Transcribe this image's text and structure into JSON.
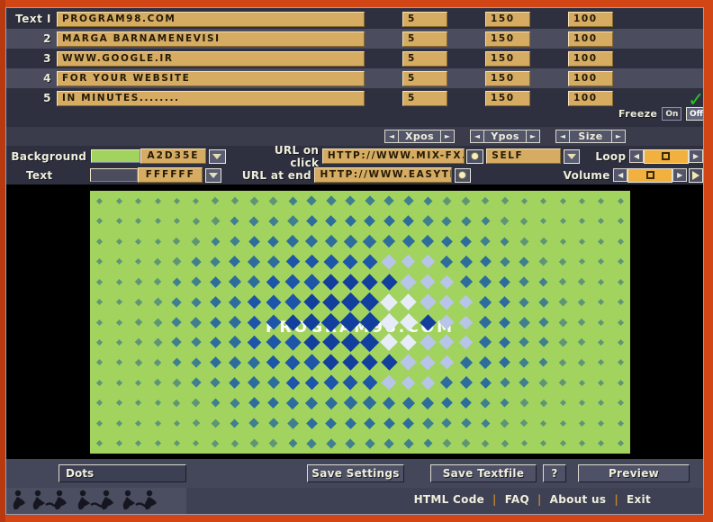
{
  "app": {
    "accent_orange": "#d24615",
    "panel_bg": "#2e3040",
    "field_bg": "#d6ab62",
    "canvas_bg": "#a2d35e"
  },
  "text_rows": [
    {
      "label": "Text I",
      "value": "PROGRAM98.COM",
      "num1": "5",
      "num2": "150",
      "num3": "100"
    },
    {
      "label": "2",
      "value": "MARGA BARNAMENEVISI",
      "num1": "5",
      "num2": "150",
      "num3": "100"
    },
    {
      "label": "3",
      "value": "WWW.GOOGLE.IR",
      "num1": "5",
      "num2": "150",
      "num3": "100"
    },
    {
      "label": "4",
      "value": "FOR YOUR WEBSITE",
      "num1": "5",
      "num2": "150",
      "num3": "100"
    },
    {
      "label": "5",
      "value": "IN MINUTES........",
      "num1": "5",
      "num2": "150",
      "num3": "100"
    }
  ],
  "freeze": {
    "label": "Freeze",
    "on_label": "On",
    "off_label": "Off",
    "selected": "Off",
    "check_mark": "✓"
  },
  "spinners": [
    {
      "label": "Xpos",
      "left": "◄",
      "right": "►"
    },
    {
      "label": "Ypos",
      "left": "◄",
      "right": "►"
    },
    {
      "label": "Size",
      "left": "◄",
      "right": "►"
    }
  ],
  "settings": {
    "background_label": "Background",
    "background_hex": "A2D35E",
    "background_color": "#a2d35e",
    "text_label": "Text",
    "text_hex": "FFFFFF",
    "text_color": "#4b4d5f",
    "url_click_label": "URL on click",
    "url_click_value": "HTTP://WWW.MIX-FX.COM",
    "target_value": "SELF",
    "url_end_label": "URL at end",
    "url_end_value": "HTTP://WWW.EASYTEMPLAT",
    "loop_label": "Loop",
    "volume_label": "Volume"
  },
  "preview": {
    "overlay_text": "PROGRAM98.COM",
    "effect_name": "Dots"
  },
  "buttons": {
    "save_settings": "Save Settings",
    "save_textfile": "Save Textfile",
    "help": "?",
    "preview": "Preview"
  },
  "footer": {
    "links": [
      "HTML Code",
      "FAQ",
      "About us",
      "Exit"
    ],
    "separator": "|"
  }
}
